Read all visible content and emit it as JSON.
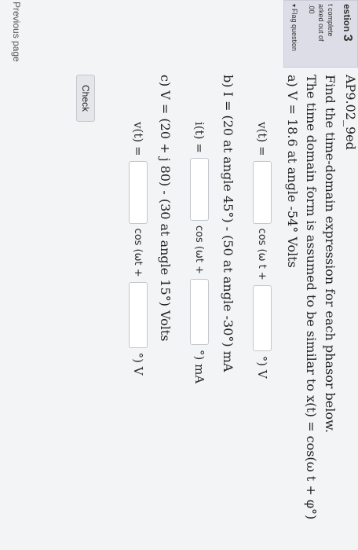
{
  "sidebar": {
    "question_label": "estion",
    "question_number": "3",
    "status": "t complete",
    "marked_line": "arked out of",
    "marks": ".00",
    "flag_label": "Flag question"
  },
  "nav": {
    "previous_page": "Previous page"
  },
  "question": {
    "id": "AP9.02_9ed",
    "instruction": "Find the time-domain expression for each phasor below.",
    "assumption": "The time domain form is assumed to be similar to x(t) = cos(ω t + φ°)",
    "part_a": {
      "prompt": "a) V = 18.6  at angle -54° Volts",
      "answer_label": "v(t) =",
      "cos_text": "cos (ω t +",
      "unit": "°) V"
    },
    "part_b": {
      "prompt": "b) I = (20  at angle 45°) - (50  at angle -30°) mA",
      "answer_label": "i(t)  =",
      "cos_text": "cos (ωt +",
      "unit": "°) mA"
    },
    "part_c": {
      "prompt": "c) V = (20 + j 80) - (30 at angle 15°) Volts",
      "answer_label": "v(t)  =",
      "cos_text": "cos (ωt +",
      "unit": "°) V"
    }
  },
  "buttons": {
    "check": "Check"
  }
}
